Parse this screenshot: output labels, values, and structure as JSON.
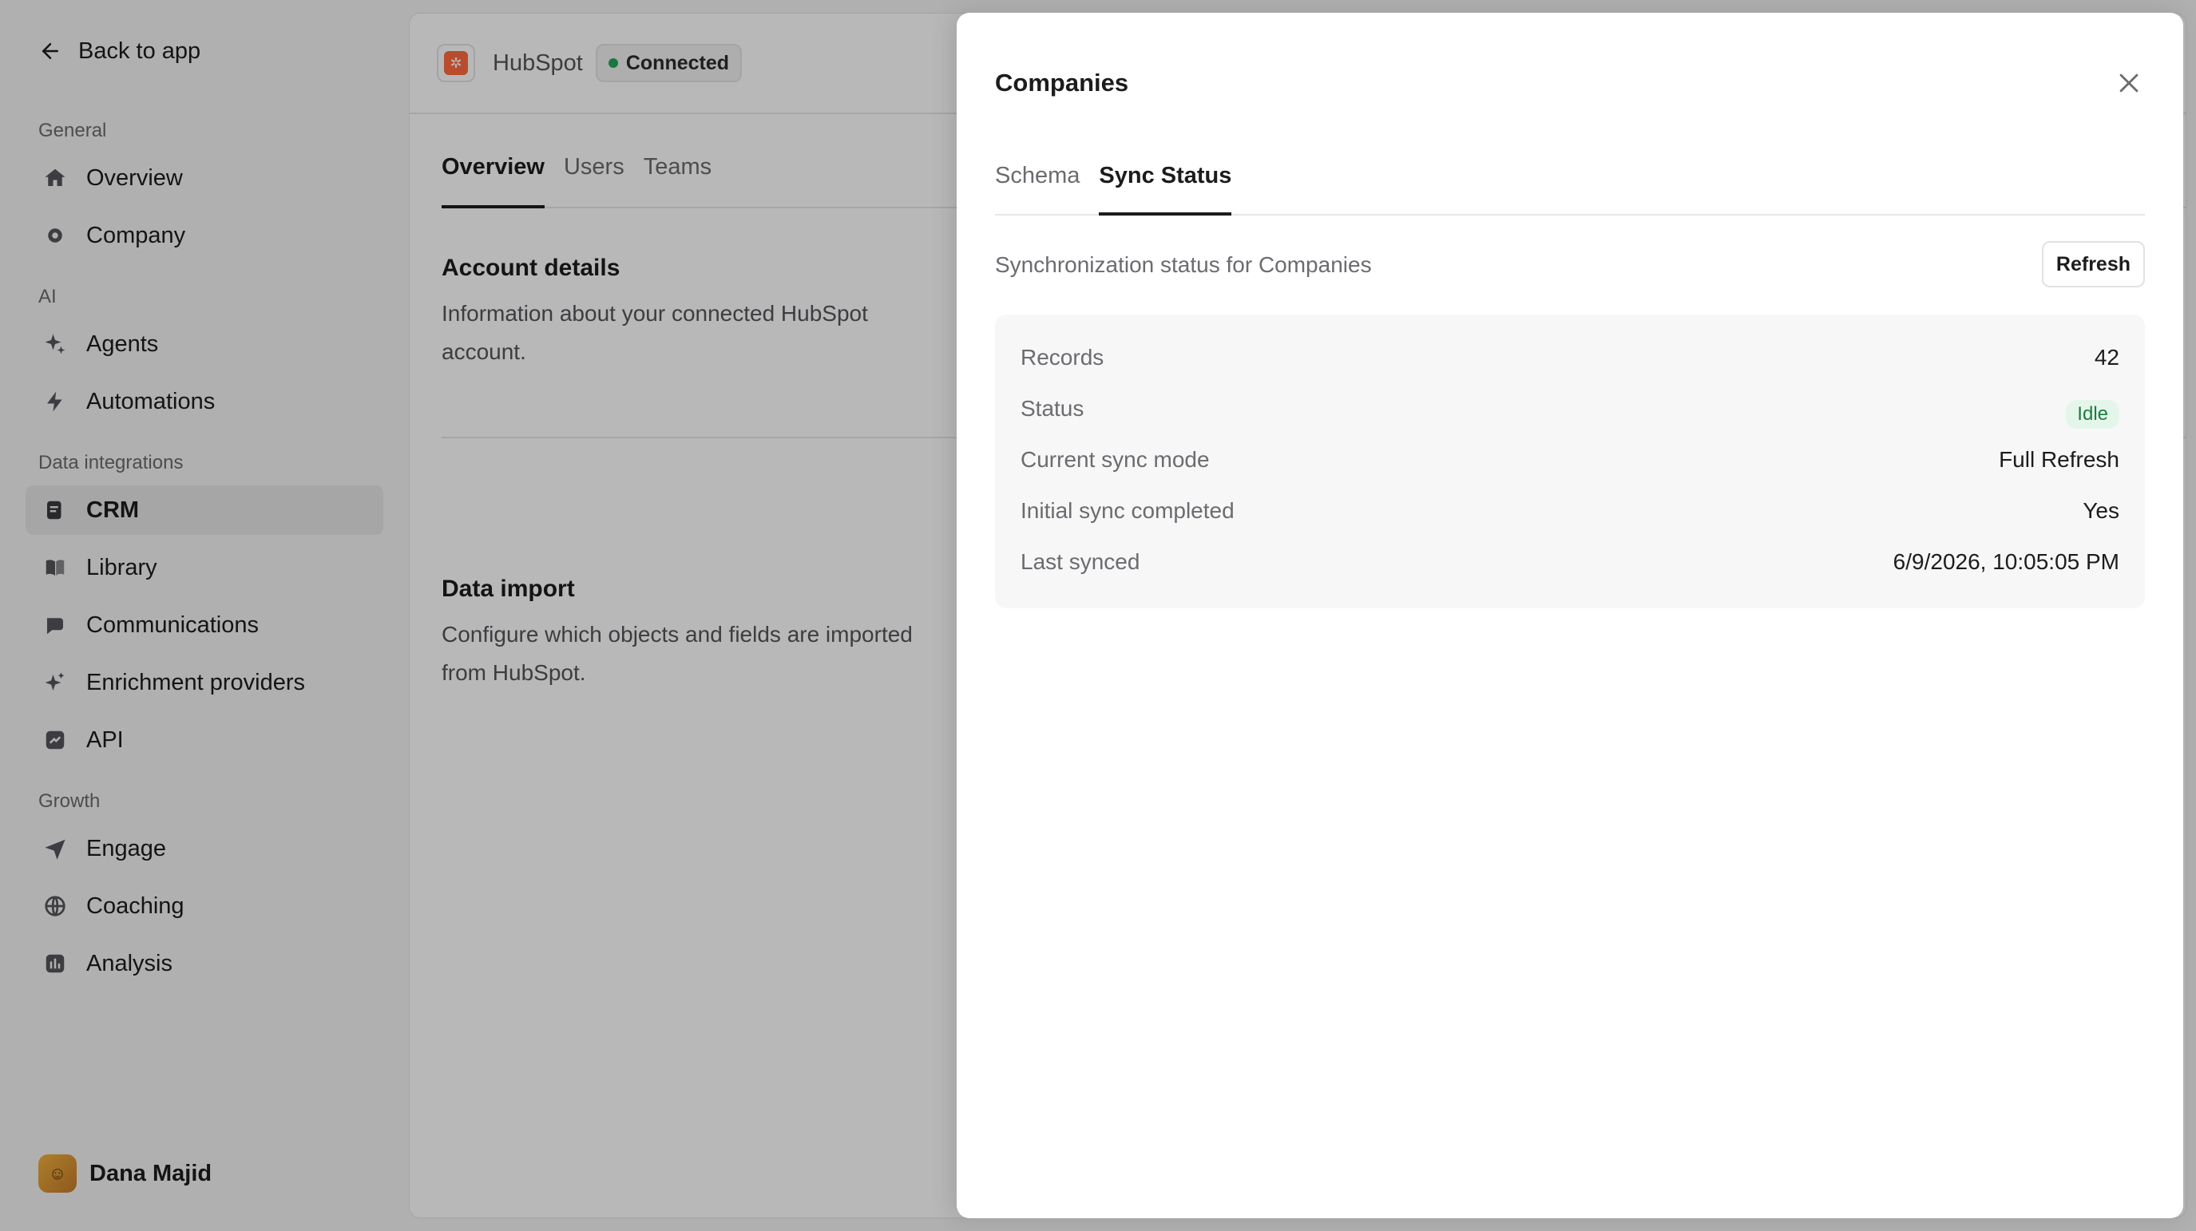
{
  "sidebar": {
    "back_label": "Back to app",
    "sections": {
      "general": "General",
      "ai": "AI",
      "data_integrations": "Data integrations",
      "growth": "Growth"
    },
    "items": {
      "overview": "Overview",
      "company": "Company",
      "agents": "Agents",
      "automations": "Automations",
      "crm": "CRM",
      "library": "Library",
      "communications": "Communications",
      "enrichment": "Enrichment providers",
      "api": "API",
      "engage": "Engage",
      "coaching": "Coaching",
      "analysis": "Analysis"
    },
    "user": {
      "name": "Dana Majid"
    }
  },
  "main": {
    "integration_name": "HubSpot",
    "status_badge": "Connected",
    "tabs": [
      "Overview",
      "Users",
      "Teams"
    ],
    "account": {
      "title": "Account details",
      "description": "Information about your connected HubSpot account."
    },
    "data_import": {
      "title": "Data import",
      "description": "Configure which objects and fields are imported from HubSpot."
    }
  },
  "drawer": {
    "title": "Companies",
    "tabs": [
      "Schema",
      "Sync Status"
    ],
    "description": "Synchronization status for Companies",
    "refresh_label": "Refresh",
    "rows": {
      "records": {
        "label": "Records",
        "value": "42"
      },
      "status": {
        "label": "Status",
        "value": "Idle"
      },
      "mode": {
        "label": "Current sync mode",
        "value": "Full Refresh"
      },
      "initial": {
        "label": "Initial sync completed",
        "value": "Yes"
      },
      "last": {
        "label": "Last synced",
        "value": "6/9/2026, 10:05:05 PM"
      }
    }
  },
  "colors": {
    "accent_connected": "#25a55a",
    "idle_badge_bg": "#e4f6ea",
    "hubspot_orange": "#ff6a3d"
  }
}
